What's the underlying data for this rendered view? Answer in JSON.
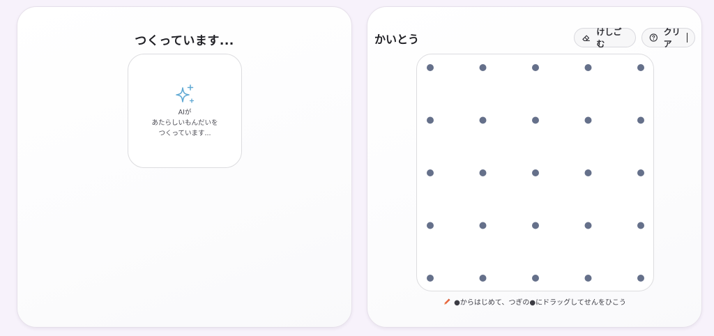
{
  "left_panel": {
    "title": "つくっています...",
    "card": {
      "icon": "sparkle-icon",
      "lines": [
        "AIが",
        "あたらしいもんだいを",
        "つくっています..."
      ]
    }
  },
  "right_panel": {
    "title": "かいとう",
    "eraser_button": {
      "label": "けしごむ",
      "icon": "eraser-icon"
    },
    "help_button": {
      "label": "クリア",
      "icon": "question-circle-icon"
    },
    "dot_grid": {
      "rows": 5,
      "cols": 5,
      "dot_color": "#65708a"
    },
    "hint": {
      "icon": "pencil-icon",
      "text": "●からはじめて、つぎの●にドラッグしてせんをひこう"
    }
  },
  "colors": {
    "accent_sparkle": "#5fa8d3",
    "pencil": "#e8683f",
    "background": "#f7f2fb"
  }
}
